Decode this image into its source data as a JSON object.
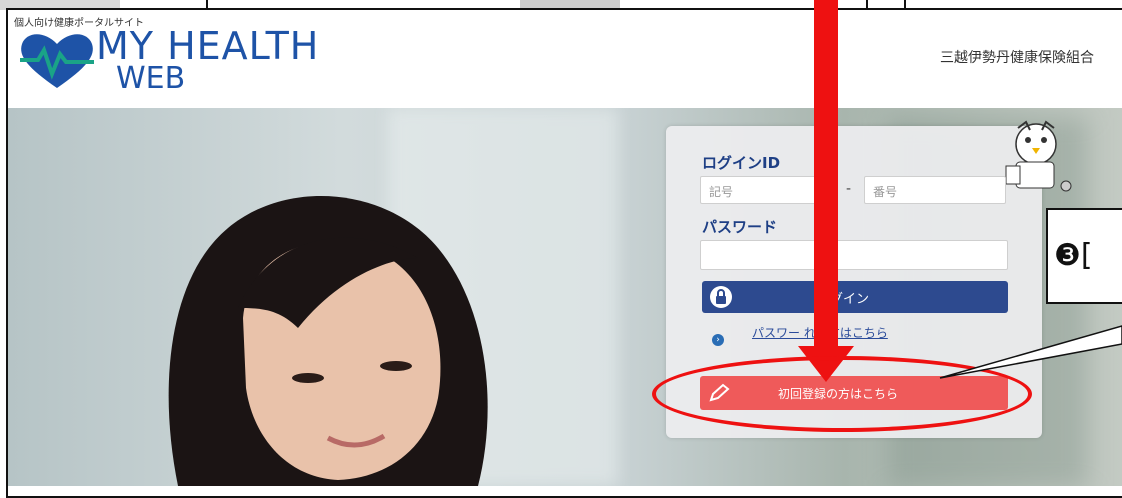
{
  "header": {
    "site_tag": "個人向け健康ポータルサイト",
    "brand_line1": "MY HEALTH",
    "brand_line2": "WEB",
    "organization": "三越伊勢丹健康保険組合"
  },
  "login": {
    "id_label": "ログインID",
    "symbol_placeholder": "記号",
    "separator": "-",
    "number_placeholder": "番号",
    "password_label": "パスワード",
    "login_button": "グイン",
    "forgot_link": "パスワー      れた方はこちら",
    "forgot_bullet": "›",
    "register_button": "初回登録の方はこちら"
  },
  "annotation": {
    "callout_text": "❸[",
    "color": "#ee1111"
  },
  "colors": {
    "brand_blue": "#1e53a7",
    "login_button": "#2d4a8f",
    "register_button": "#ef5a5a",
    "logo_teal": "#1aa387"
  }
}
